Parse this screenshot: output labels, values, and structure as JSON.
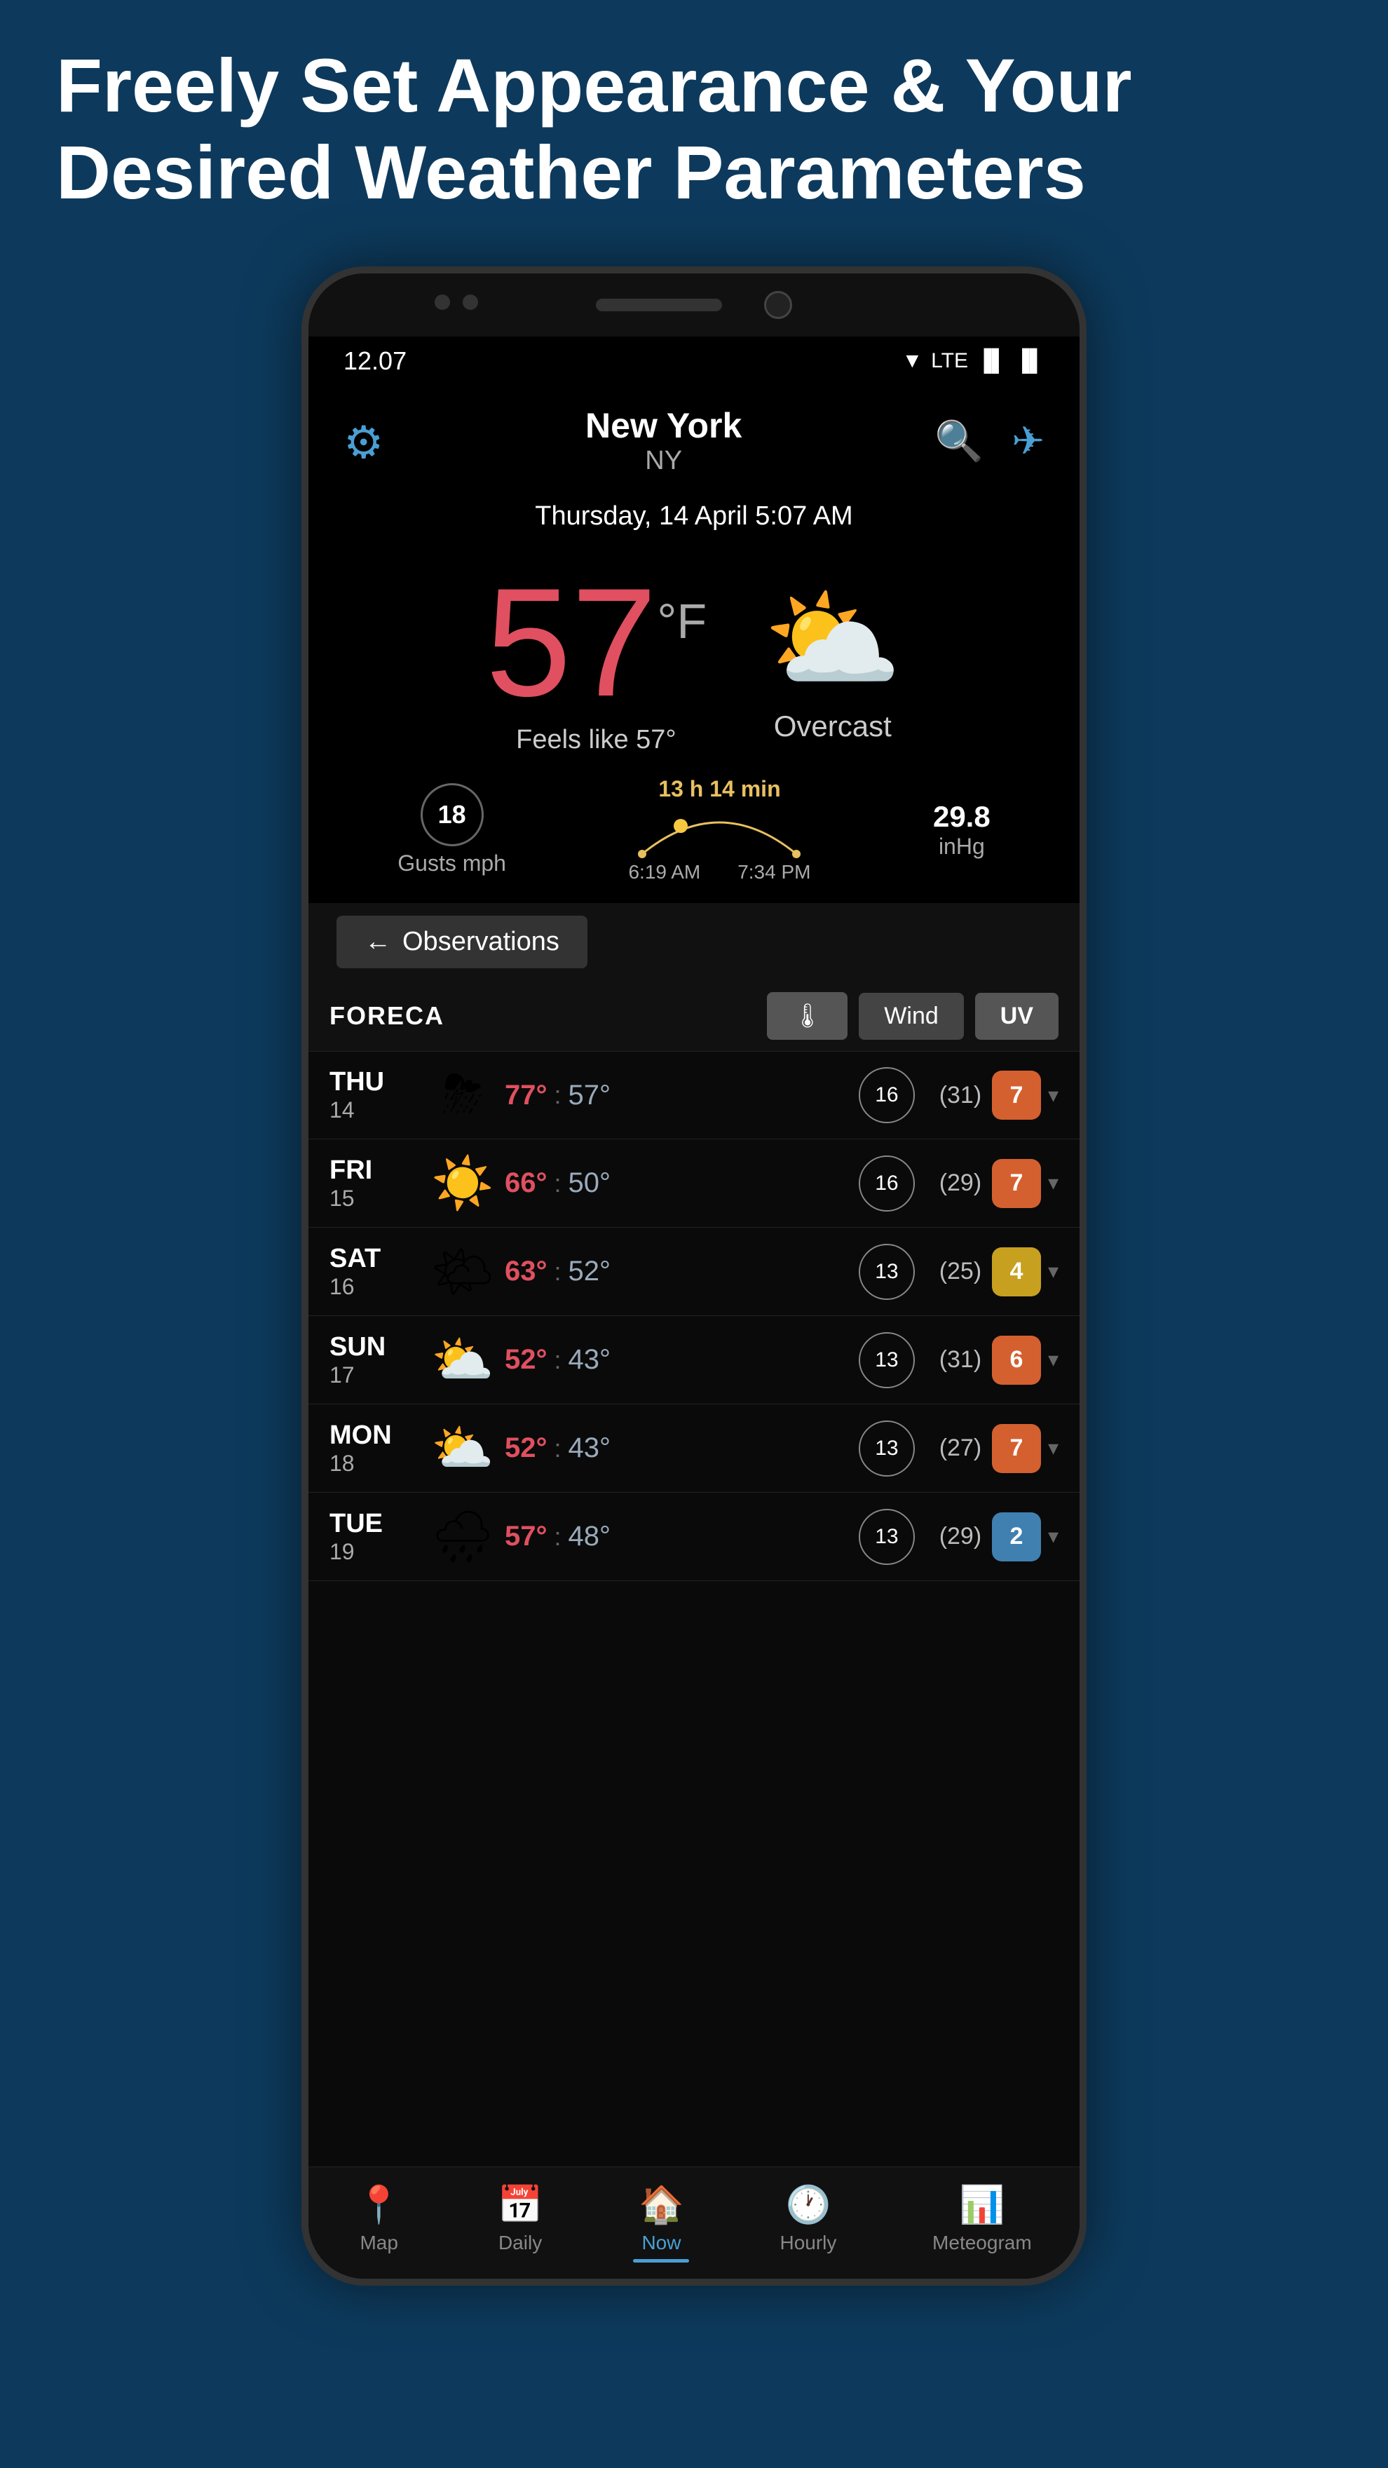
{
  "page": {
    "header_line1": "Freely Set Appearance & Your",
    "header_line2": "Desired Weather Parameters"
  },
  "status_bar": {
    "time": "12.07",
    "wifi_icon": "▼",
    "lte_label": "LTE",
    "signal_icon": "▐",
    "battery_icon": "▐"
  },
  "app_header": {
    "city": "New York",
    "state": "NY",
    "gear_icon": "⚙",
    "search_icon": "🔍",
    "location_icon": "✈"
  },
  "date_bar": {
    "text": "Thursday, 14 April 5:07 AM"
  },
  "weather": {
    "temperature": "57",
    "unit": "°F",
    "feels_like": "Feels like 57°",
    "cloud_icon": "⛅",
    "description": "Overcast",
    "gusts_value": "18",
    "gusts_label": "Gusts mph",
    "sun_duration": "13 h 14 min",
    "sunrise": "6:19 AM",
    "sunset": "7:34 PM",
    "pressure_value": "29.8",
    "pressure_unit": "inHg"
  },
  "observations_btn": {
    "arrow": "←",
    "label": "Observations"
  },
  "foreca": {
    "logo": "FORECA",
    "tab_temp": "🌡",
    "tab_wind": "Wind",
    "tab_uv": "UV"
  },
  "forecast": [
    {
      "day": "THU",
      "date": "14",
      "icon": "⛈",
      "temp_hi": "77°",
      "temp_lo": "57°",
      "wind": "16",
      "wind_gust": "(31)",
      "uv": "7",
      "uv_class": "uv-orange"
    },
    {
      "day": "FRI",
      "date": "15",
      "icon": "☀️",
      "temp_hi": "66°",
      "temp_lo": "50°",
      "wind": "16",
      "wind_gust": "(29)",
      "uv": "7",
      "uv_class": "uv-orange"
    },
    {
      "day": "SAT",
      "date": "16",
      "icon": "🌤",
      "temp_hi": "63°",
      "temp_lo": "52°",
      "wind": "13",
      "wind_gust": "(25)",
      "uv": "4",
      "uv_class": "uv-yellow"
    },
    {
      "day": "SUN",
      "date": "17",
      "icon": "⛅",
      "temp_hi": "52°",
      "temp_lo": "43°",
      "wind": "13",
      "wind_gust": "(31)",
      "uv": "6",
      "uv_class": "uv-orange"
    },
    {
      "day": "MON",
      "date": "18",
      "icon": "⛅",
      "temp_hi": "52°",
      "temp_lo": "43°",
      "wind": "13",
      "wind_gust": "(27)",
      "uv": "7",
      "uv_class": "uv-orange"
    },
    {
      "day": "TUE",
      "date": "19",
      "icon": "🌧",
      "temp_hi": "57°",
      "temp_lo": "48°",
      "wind": "13",
      "wind_gust": "(29)",
      "uv": "2",
      "uv_class": "uv-blue"
    }
  ],
  "bottom_nav": [
    {
      "icon": "📍",
      "label": "Map",
      "active": false
    },
    {
      "icon": "📅",
      "label": "Daily",
      "active": false
    },
    {
      "icon": "🏠",
      "label": "Now",
      "active": true
    },
    {
      "icon": "🕐",
      "label": "Hourly",
      "active": false
    },
    {
      "icon": "📊",
      "label": "Meteogram",
      "active": false
    }
  ]
}
